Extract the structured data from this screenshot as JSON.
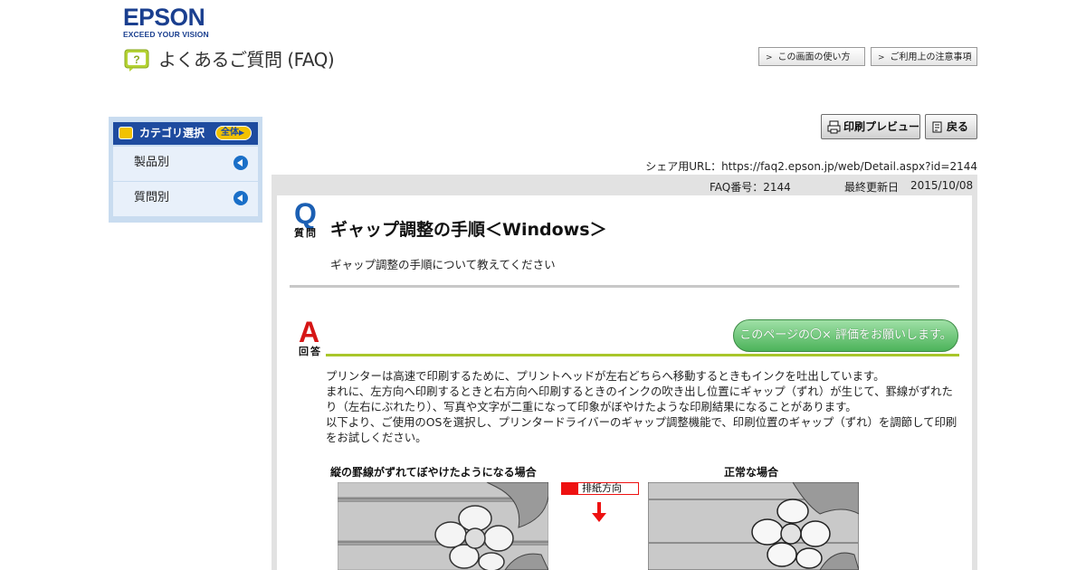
{
  "brand": {
    "name": "EPSON",
    "tagline": "EXCEED YOUR VISION",
    "color": "#1a3f8f"
  },
  "header": {
    "faq_title": "よくあるご質問 (FAQ)",
    "faq_icon_glyph": "?",
    "links": [
      {
        "label": "この画面の使い方"
      },
      {
        "label": "ご利用上の注意事項"
      }
    ]
  },
  "sidebar": {
    "title": "カテゴリ選択",
    "all_label": "全体",
    "items": [
      {
        "label": "製品別"
      },
      {
        "label": "質問別"
      }
    ]
  },
  "toolbar": {
    "print_preview": "印刷プレビュー",
    "back": "戻る"
  },
  "share": {
    "text": "シェア用URL：https://faq2.epson.jp/web/Detail.aspx?id=2144"
  },
  "meta": {
    "faq_no": "FAQ番号：2144",
    "updated_label": "最終更新日",
    "updated_date": "2015/10/08"
  },
  "question": {
    "mark": "Q",
    "mark_label": "質問",
    "title": "ギャップ調整の手順＜Windows＞",
    "description": "ギャップ調整の手順について教えてください"
  },
  "answer": {
    "mark": "A",
    "mark_label": "回答",
    "rate_button": "このページの〇× 評価をお願いします。",
    "paragraphs": [
      "プリンターは高速で印刷するために、プリントヘッドが左右どちらへ移動するときもインクを吐出しています。",
      "まれに、左方向へ印刷するときと右方向へ印刷するときのインクの吹き出し位置にギャップ（ずれ）が生じて、罫線がずれたり（左右にぶれたり）、写真や文字が二重になって印象がぼやけたような印刷結果になることがあります。",
      "以下より、ご使用のOSを選択し、プリンタードライバーのギャップ調整機能で、印刷位置のギャップ（ずれ）を調節して印刷をお試しください。"
    ],
    "figure": {
      "left_caption": "縦の罫線がずれてぼやけたようになる場合",
      "right_caption": "正常な場合",
      "feed_label": "排紙方向"
    }
  },
  "colors": {
    "accent_blue": "#1b5fb3",
    "answer_red": "#d61616",
    "rule_green": "#a8c62a",
    "rate_green": "#4cb35a"
  }
}
